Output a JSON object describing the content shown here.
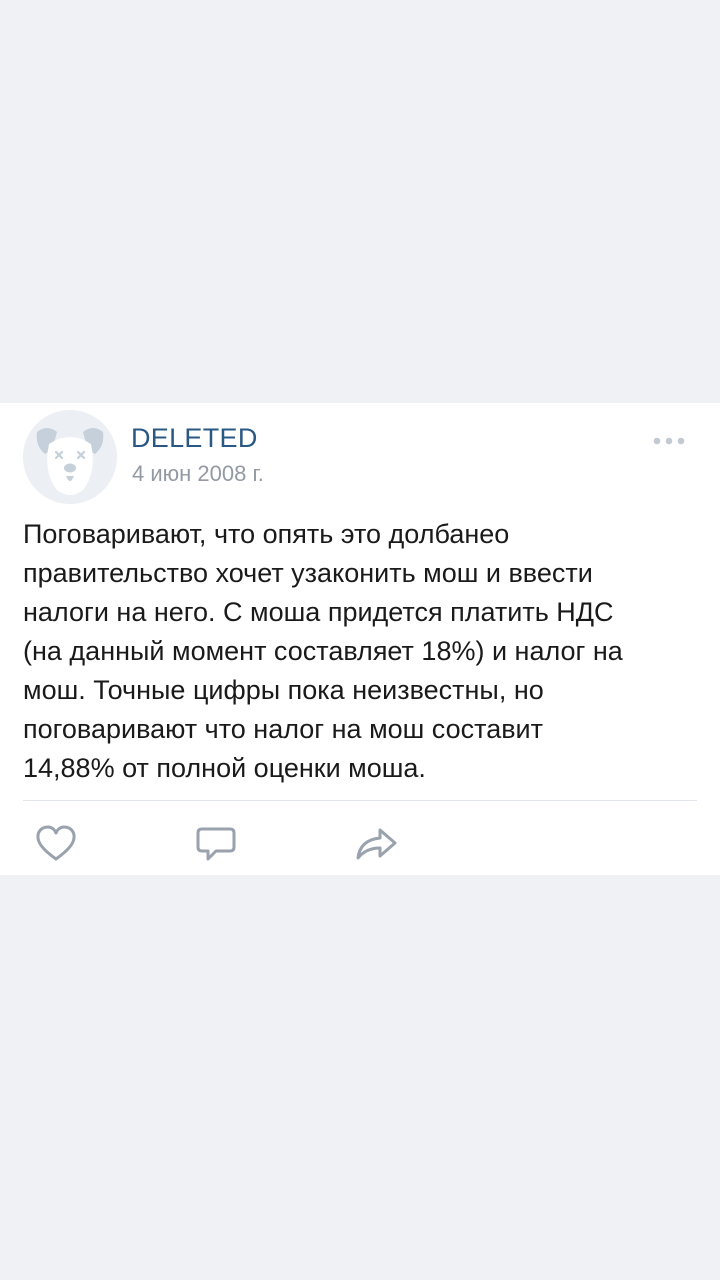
{
  "post": {
    "author": "DELETED",
    "date": "4 июн 2008 г.",
    "text_lines": [
      "Поговаривают, что опять это долбанео",
      "правительство хочет узаконить мош и ввести",
      "налоги на него. С моша придется платить НДС",
      "(на данный момент составляет 18%) и налог на",
      "мош. Точные цифры пока неизвестны, но",
      "поговаривают что налог на мош составит",
      "14,88% от полной оценки моша."
    ]
  },
  "icons": {
    "avatar": "deleted-dog-avatar",
    "more": "more-dots-icon",
    "like": "heart-icon",
    "comment": "comment-icon",
    "share": "share-arrow-icon"
  },
  "colors": {
    "background": "#f0f1f4",
    "card": "#ffffff",
    "author": "#2a5885",
    "date": "#939aa3",
    "icon": "#99a2ad",
    "avatar_bg": "#ecf0f4",
    "avatar_fg": "#c5d0db"
  }
}
